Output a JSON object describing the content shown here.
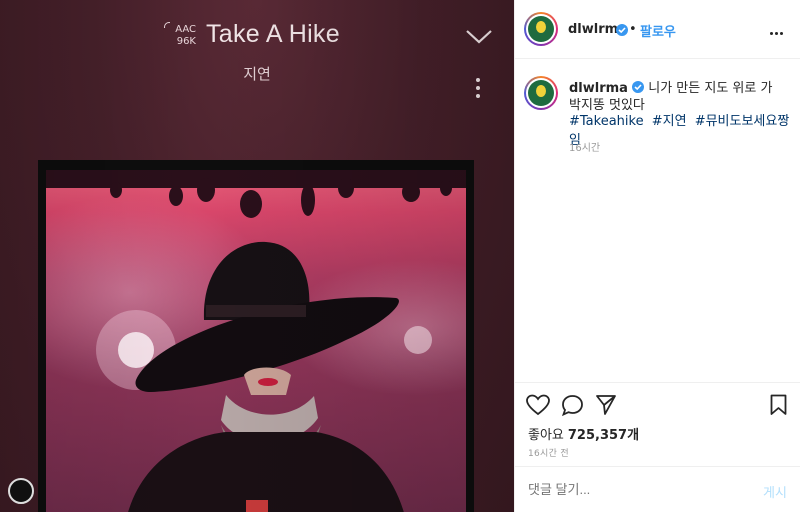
{
  "player": {
    "codec": "AAC",
    "bitrate": "96K",
    "song_title": "Take A Hike",
    "artist": "지연"
  },
  "post": {
    "username": "dlwlrma",
    "follow_label": "팔로우",
    "caption": "니가 만든 지도 위로 가 박지똥 멋있다",
    "hashtags": [
      "#Takeahike",
      "#지연",
      "#뮤비도보세요짱임"
    ],
    "caption_time": "16시간",
    "likes_label": "좋아요",
    "likes_count": "725,357개",
    "post_time": "16시간 전",
    "comment_placeholder": "댓글 달기...",
    "post_button": "게시"
  },
  "colors": {
    "accent": "#3897f0",
    "hashtag": "#003569",
    "muted": "#999999"
  },
  "icons": [
    "audio-wave-icon",
    "chevron-down-icon",
    "more-vertical-icon",
    "verified-icon",
    "more-horizontal-icon",
    "heart-icon",
    "comment-icon",
    "share-icon",
    "bookmark-icon",
    "profile-icon"
  ]
}
